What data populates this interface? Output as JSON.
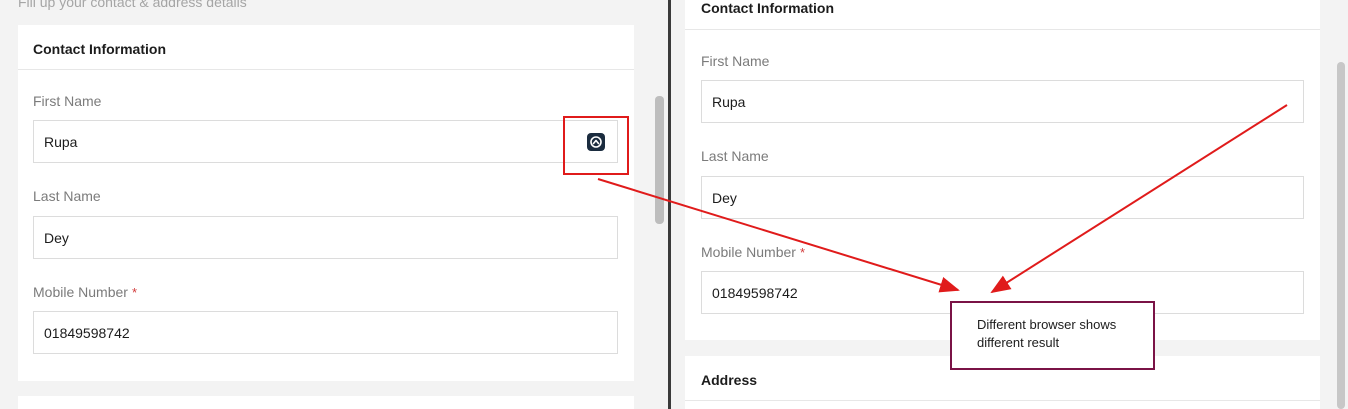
{
  "left": {
    "subtitle": "Fill up your contact & address details",
    "contact": {
      "title": "Contact Information",
      "first_name": {
        "label": "First Name",
        "value": "Rupa"
      },
      "last_name": {
        "label": "Last Name",
        "value": "Dey"
      },
      "mobile": {
        "label": "Mobile Number",
        "required": "*",
        "value": "01849598742"
      }
    }
  },
  "right": {
    "contact": {
      "title": "Contact Information",
      "first_name": {
        "label": "First Name",
        "value": "Rupa"
      },
      "last_name": {
        "label": "Last Name",
        "value": "Dey"
      },
      "mobile": {
        "label": "Mobile Number",
        "required": "*",
        "value": "01849598742"
      }
    },
    "address": {
      "title": "Address"
    }
  },
  "annotation": {
    "note": "Different browser shows different result",
    "colors": {
      "arrow": "#e01b1b",
      "note_border": "#7a1346"
    }
  },
  "icons": {
    "autofill": "password-manager-icon"
  }
}
